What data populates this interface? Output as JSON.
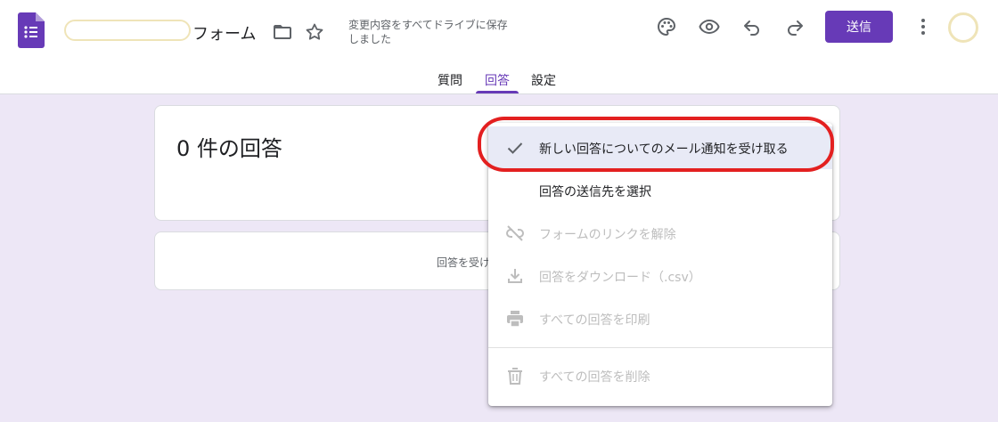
{
  "header": {
    "form_title_suffix": "フォーム",
    "save_status": "変更内容をすべてドライブに保存しました",
    "send_label": "送信",
    "brand_color": "#673ab7"
  },
  "tabs": [
    {
      "label": "質問",
      "active": false
    },
    {
      "label": "回答",
      "active": true
    },
    {
      "label": "設定",
      "active": false
    }
  ],
  "responses": {
    "count_title": "0 件の回答",
    "status_text": "回答を受け"
  },
  "menu": {
    "items": [
      {
        "label": "新しい回答についてのメール通知を受け取る",
        "icon": "check-icon",
        "enabled": true,
        "checked": true
      },
      {
        "label": "回答の送信先を選択",
        "icon": "",
        "enabled": true
      },
      {
        "label": "フォームのリンクを解除",
        "icon": "link-off-icon",
        "enabled": false
      },
      {
        "label": "回答をダウンロード（.csv）",
        "icon": "download-icon",
        "enabled": false
      },
      {
        "label": "すべての回答を印刷",
        "icon": "print-icon",
        "enabled": false
      },
      {
        "label": "すべての回答を削除",
        "icon": "trash-icon",
        "enabled": false
      }
    ]
  },
  "annotation_color": "#e32020"
}
